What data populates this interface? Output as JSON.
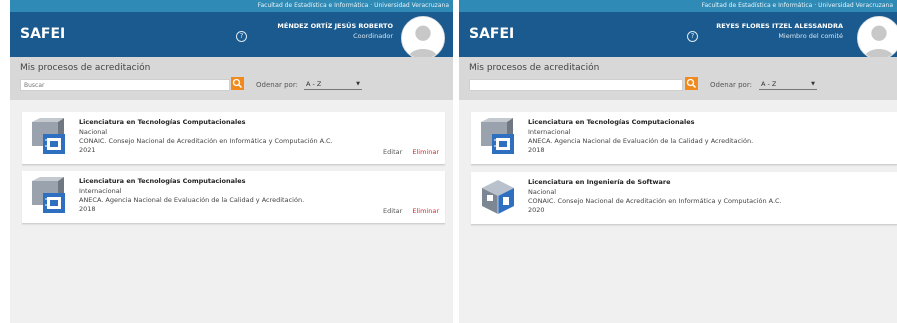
{
  "screens": [
    {
      "topbar": "Facultad de Estadística e Informática · Universidad Veracruzana",
      "header": {
        "app_name": "SAFEI",
        "user_name": "MÉNDEZ ORTÍZ JESÚS ROBERTO",
        "user_role": "Coordinador"
      },
      "subheader": {
        "title": "Mis procesos de acreditación",
        "search_placeholder": "Buscar",
        "order_label": "Odenar por:",
        "order_value": "A - Z"
      },
      "cards": [
        {
          "title": "Licenciatura en Tecnologías Computacionales",
          "scope": "Nacional",
          "agency": "CONAIC. Consejo Nacional de Acreditación en Informática y Computación A.C.",
          "year": "2021",
          "edit": "Editar",
          "delete": "Eliminar"
        },
        {
          "title": "Licenciatura en Tecnologías Computacionales",
          "scope": "Internacional",
          "agency": "ANECA. Agencia Nacional de Evaluación de la Calidad y Acreditación.",
          "year": "2018",
          "edit": "Editar",
          "delete": "Eliminar"
        }
      ]
    },
    {
      "topbar": "Facultad de Estadística e Informática · Universidad Veracruzana",
      "header": {
        "app_name": "SAFEI",
        "user_name": "REYES FLORES ITZEL ALESSANDRA",
        "user_role": "Miembro del comité"
      },
      "subheader": {
        "title": "Mis procesos de acreditación",
        "search_placeholder": "",
        "order_label": "Odenar por:",
        "order_value": "A - Z"
      },
      "cards": [
        {
          "title": "Licenciatura en Tecnologías Computacionales",
          "scope": "Internacional",
          "agency": "ANECA. Agencia Nacional de Evaluación de la Calidad y Acreditación.",
          "year": "2018"
        },
        {
          "title": "Licenciatura en Ingeniería de Software",
          "scope": "Nacional",
          "agency": "CONAIC. Consejo Nacional de Acreditación en Informática y Computación A.C.",
          "year": "2020"
        }
      ]
    }
  ],
  "icons": {
    "help": "question-circle-icon",
    "search": "magnifier-icon",
    "avatar": "user-silhouette-icon",
    "program_tc": "computer-chip-tile-icon",
    "program_is": "software-cube-icon",
    "select_chevron": "chevron-down-icon"
  },
  "colors": {
    "topbar": "#2f8ab5",
    "header": "#1a5a8e",
    "search_button": "#f08a1c",
    "delete_link": "#d8262c",
    "background": "#f0f0f0"
  }
}
